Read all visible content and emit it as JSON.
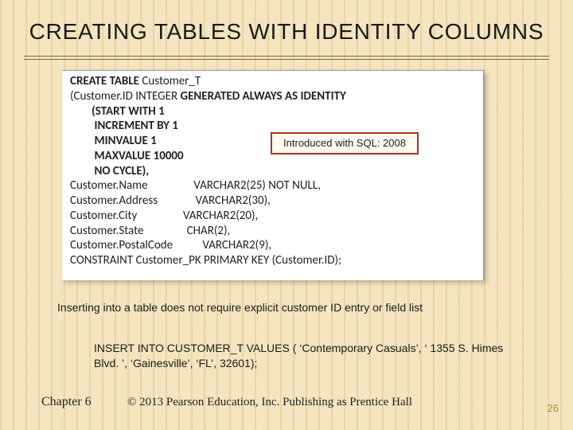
{
  "title": "CREATING TABLES WITH IDENTITY COLUMNS",
  "code": {
    "l1a": "CREATE TABLE",
    "l1b": " Customer_T",
    "l2a": "(Customer.ID INTEGER ",
    "l2b": "GENERATED ALWAYS AS IDENTITY",
    "l3": "        (START WITH 1",
    "l4": "         INCREMENT BY 1",
    "l5": "         MINVALUE 1",
    "l6": "         MAXVALUE 10000",
    "l7": "         NO CYCLE),",
    "l8": "Customer.Name                 VARCHAR2(25) NOT NULL,",
    "l9": "Customer.Address              VARCHAR2(30),",
    "l10": "Customer.City                 VARCHAR2(20),",
    "l11": "Customer.State                CHAR(2),",
    "l12": "Customer.PostalCode           VARCHAR2(9),",
    "l13": "CONSTRAINT Customer_PK PRIMARY KEY (Customer.ID);"
  },
  "callout": "Introduced with SQL: 2008",
  "note": "Inserting into a table does not require explicit customer ID entry or field list",
  "insert": "INSERT INTO CUSTOMER_T VALUES ( ‘Contemporary Casuals’, ‘ 1355 S. Himes Blvd. ’, ‘Gainesville’, ‘FL’, 32601);",
  "chapter": "Chapter 6",
  "copyright": "© 2013 Pearson Education, Inc.  Publishing as Prentice Hall",
  "page": "26"
}
